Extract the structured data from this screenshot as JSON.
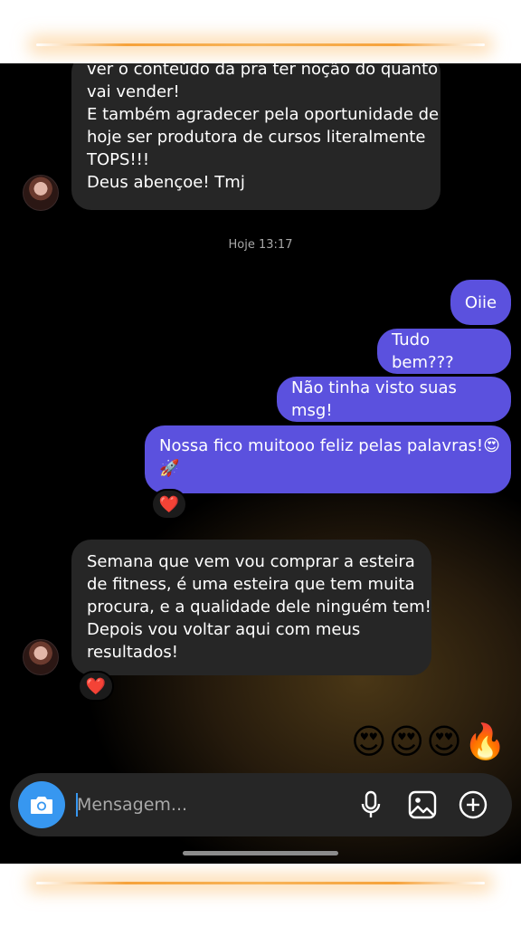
{
  "colors": {
    "background": "#000000",
    "incoming_bubble": "#262626",
    "outgoing_bubble": "#5b51de",
    "camera_button": "#3797f0",
    "heart": "#ff2d4a",
    "frame_glow": "#f6a23a"
  },
  "thread": {
    "first_message_lines": [
      "ver o conteúdo da pra ter noção do quanto",
      "vai vender!",
      "E também agradecer pela oportunidade de",
      "hoje ser produtora de cursos literalmente",
      "TOPS!!!",
      "Deus abençoe! Tmj"
    ],
    "timestamp": "Hoje 13:17",
    "outgoing": [
      "Oiie",
      "Tudo bem???",
      "Não tinha visto suas msg!"
    ],
    "outgoing_long_lines": [
      "Nossa fico muitooo feliz pelas palavras!😍",
      "🚀"
    ],
    "reaction_heart": "❤️",
    "second_message_lines": [
      "Semana que vem vou comprar a esteira",
      "de fitness, é uma esteira que tem muita",
      "procura, e a qualidade dele ninguém tem!",
      "Depois vou voltar aqui com meus",
      "resultados!"
    ],
    "emoji_reply": [
      "😍",
      "😍",
      "😍",
      "🔥"
    ]
  },
  "composer": {
    "placeholder": "Mensagem...",
    "icons": [
      "camera-icon",
      "microphone-icon",
      "gallery-icon",
      "add-circle-icon"
    ]
  }
}
